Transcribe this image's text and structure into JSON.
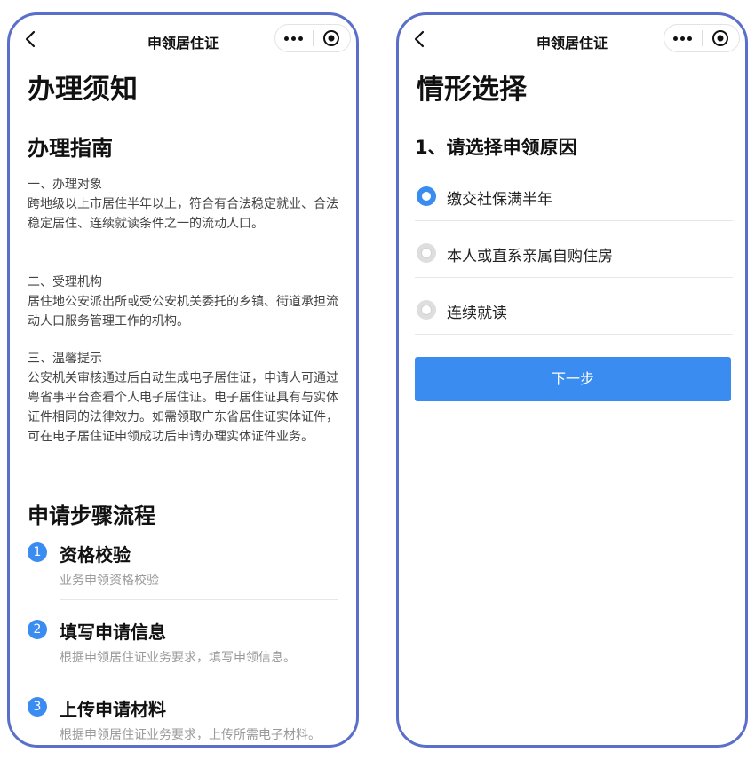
{
  "left_screen": {
    "nav": {
      "title": "申领居住证"
    },
    "page_title": "办理须知",
    "guide": {
      "title": "办理指南",
      "sections": [
        {
          "heading": "一、办理对象",
          "body": "跨地级以上市居住半年以上，符合有合法稳定就业、合法稳定居住、连续就读条件之一的流动人口。"
        },
        {
          "heading": "二、受理机构",
          "body": "居住地公安派出所或受公安机关委托的乡镇、街道承担流动人口服务管理工作的机构。"
        },
        {
          "heading": "三、温馨提示",
          "body": "公安机关审核通过后自动生成电子居住证，申请人可通过粤省事平台查看个人电子居住证。电子居住证具有与实体证件相同的法律效力。如需领取广东省居住证实体证件，可在电子居住证申领成功后申请办理实体证件业务。"
        }
      ]
    },
    "steps": {
      "title": "申请步骤流程",
      "items": [
        {
          "num": "1",
          "title": "资格校验",
          "desc": "业务申领资格校验"
        },
        {
          "num": "2",
          "title": "填写申请信息",
          "desc": "根据申领居住证业务要求，填写申领信息。"
        },
        {
          "num": "3",
          "title": "上传申请材料",
          "desc": "根据申领居住证业务要求，上传所需电子材料。"
        }
      ]
    }
  },
  "right_screen": {
    "nav": {
      "title": "申领居住证"
    },
    "page_title": "情形选择",
    "question": "1、请选择申领原因",
    "options": [
      {
        "label": "缴交社保满半年",
        "selected": true
      },
      {
        "label": "本人或直系亲属自购住房",
        "selected": false
      },
      {
        "label": "连续就读",
        "selected": false
      }
    ],
    "next_button": "下一步"
  },
  "colors": {
    "frame_border": "#5a6fc9",
    "accent": "#3b8cf0",
    "muted_text": "#9a9a9a"
  },
  "icons": [
    "back-arrow-icon",
    "more-dots-icon",
    "target-icon",
    "radio-checked-icon",
    "radio-unchecked-icon"
  ]
}
